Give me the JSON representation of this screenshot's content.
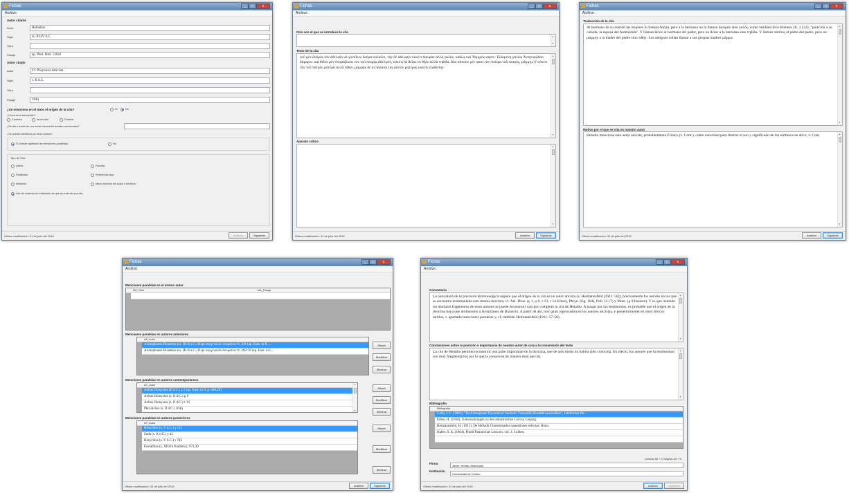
{
  "app": {
    "title": "Fichas",
    "menu": "Archivo",
    "status": "Última modificación: 31 de julio del 2015",
    "prev": "Anterior",
    "next": "Siguiente"
  },
  "w1": {
    "autor_citante": "Autor citante",
    "autor_citado": "Autor citado",
    "labels": {
      "autor": "Autor",
      "siglo": "Siglo",
      "obra": "Obra",
      "pasaje": "Pasaje"
    },
    "citante": {
      "autor": "Helladius",
      "siglo": "ss. III-IV d.C.",
      "obra": "",
      "pasaje": "ap. Phot. Bibl. 530a3"
    },
    "citado": {
      "autor": "Cf. Phrynicus Atticista",
      "siglo": "s. II d.C.",
      "obra": "",
      "pasaje": "104q"
    },
    "q_origen": "¿Se menciona en el texto el origen de la cita?",
    "si": "Sí",
    "no": "No",
    "q_adscripcion": "¿Cómo es la adscripción?",
    "correcta": "Correcta",
    "incorrecta": "Incorrecta",
    "dudosa": "Dudosa",
    "q_intermedia": "¿Se cita a través de una fuente intermedia también mencionada?:",
    "q_identificar": "¿Se pueden identificar por otros medios?",
    "si_paralelas": "Sí (Véase apartado de menciones paralelas)",
    "tipo_cita": "Tipo de Cita",
    "literal": "Literal",
    "parodia": "Parodia",
    "parafrasis": "Paráfrasis",
    "ref_laxa": "Referencia laxa",
    "imitacion": "Imitación",
    "mera_mencion": "Mera mención del autor o del título",
    "uso_material": "Uso de material sin indicación de que se trate de una cita"
  },
  "w2": {
    "giro": "Giro con el que se introduce la cita",
    "texto": "Texto de la cita",
    "texto_value": "τοῦ μὲν ἀνδρὸς τὸν ἀδελφὸν αἱ γυναῖκες δαέρα καλοῦσι, τὴν δὲ ἀδελφὴν οὐκέτι δαειρὰν ἀλλὰ γαλόν, καθὼς καὶ Ὅμηρός φησιν· Εἰδομένη γαλόῳ Ἀντηνορίδαο δάμαρτι. καὶ θεῖον μὲν ὀνομάζουσι τὸν τοῦ πατρὸς ἀδελφόν, οὐκέτι δὲ θεῖαν τὸ θῆλυ ἀλλὰ τηθίδα. Καὶ πάππον μέν φασι τὸν πατέρα τοῦ πατρός, μάμμην δ' οὐκέτι τὴν τοῦ πατρὸς μητέρα ἀλλὰ τιθήν. μάμμας δὲ οἱ παλαιοὶ τὰς αὐτῶν μητέρας καλεῖν εἰώθεσαν.",
    "aparato": "Aparato crítico"
  },
  "w3": {
    "traduccion": "Traducción de la cita",
    "traduccion_value": "Al hermano de su marido las mujeres lo llaman δαέρα, pero a la hermana no la llaman δαειρὰν sino γαλός, como también dice Homero (Il. 3.122): \"parecida a su cuñada, la esposa del Antenórida\". Y llaman θεῖον al hermano del padre, pero no θεῖαν a la hermana sino τηθίδα. Y llaman πάππος al padre del padre, pero no μάμμην a la madre del padre sino τιθήν. Los antiguos solían llamar a sus propias madres μάμμα.",
    "motivo": "Motivo por el que se cita en nuestro autor",
    "motivo_value": "Heladio menciona este autor aticista, probablemente Frínico (v. Com.), como autoridad para ilustrar el uso y significado de los términos en ático, v. Com."
  },
  "w4": {
    "mismo_autor": "Menciones paralelas en el mismo autor",
    "ma_obra": "MA_Obra",
    "ma_pasaje": "MA_Pasaje",
    "anteriores": "Menciones paralelas en autores anteriores",
    "aa_autor": "AA_Autor",
    "anteriores_rows": [
      "Aristophanes Bizantius (ss. III-II a.C.) Περὶ συγγενικῶν ὀνομάτων fr. 241 (ap. Eust. in Il. ...",
      "Aristophanes Bizantius (ss. III-II a.C.) Περὶ συγγενικῶν ὀνομάτων fr. 269-70 (ap. Eust. in I..."
    ],
    "contemporaneos": "Menciones  paralelas en autores contemporáneos",
    "ac_autor": "AC_Autor",
    "contemp_rows": [
      "Aelius Dionysius (II d.C.)  γ 1 (ap. Eust. in Il. p. 648,26)",
      "Aelius Dionysius (s. II d.C.)  μ 6",
      "Aelius Dionysius (s. II d.C.)  τ 13",
      "Phrynichus (s. II d.C.)  104q"
    ],
    "posteriores": "Menciones  paralelas en autores posteriores",
    "ap_autor": "AP_Autor",
    "post_rows": [
      "Hesychius (s. V d.C.)  γ 112",
      "Suda (s. X d.C.)  γ 43",
      "Hesychius (s. V d.C.)  τ 743",
      "Eustathius (s. XII) In Iliadem p. 971,30"
    ],
    "anadir": "Añadir",
    "modificar": "Modificar",
    "eliminar": "Eliminar"
  },
  "w5": {
    "comentario": "Comentario",
    "comentario_value": "La naturaleza de la precisión terminológica sugiere que el origen de la cita es un autor aticista (v. Heimannsfeld [1911: 58]), precisamente los autores en los que se encuentra testimoniada esta misma doctrina, cf. Ael. Dion. (γ 1, μ 6, τ 13, τ 14 Erbse), Phryn. (Eg. 104), Poll. (3.17) y Moer. (μ 9 Hansen). Y es que uniendo los distintos fragmentos de estos autores se puede reconstruir casi por completo la cita de Heladio. A juzgar por los testimonios, es probable que el origen de la doctrina haya que atribuirselo a Aristófanes de Bizancio. A partir de ahí, tuvo gran repercusión en los autores aticistas, y posteriormente en otros léxicos tardíos, v. apartado menciones paralelas y, cf. también Heimannsfeld (1911: 57-58).",
    "conclusiones": "Conclusiones sobre la posición e importancia de nuestro autor de cara a la transmisión del texto",
    "conclusiones_value": "La cita de Heladio permite reconstruir una parte importante de la doctrina, que de otro modo no habría sido conocida. En efecto, los autores que la testimonian son muy fragmentarios por lo que la conservan de manera muy parcial.",
    "bibliografia": "Bibliografía",
    "bib_header": "Bibliografia",
    "bib_rows": [
      "Cohn, L.C. (1881), \"De Aristophane Byzantio et Suetonio Tranquillo Eustathii auctoribus\", Jahrbücher für ...",
      "Erbse, H. (1950), Untersuchungen zu den attizistischen Lexica, Leipzig.",
      "Heimannsfeld, H. (1911), De Helladii Chrestomathia quaestiones selectae, Bonn.",
      "Naber, S. A. (1864), Photii Patriarchae Lexicon, vol. 1, Leiden."
    ],
    "hint": "Cursiva: Alt + C   Negrita: Alt + N",
    "firma": "Firma",
    "firma_value": "Javier Verdejo Manchado",
    "institucion": "Institución",
    "institucion_value": "Universidad de Oviedo"
  }
}
